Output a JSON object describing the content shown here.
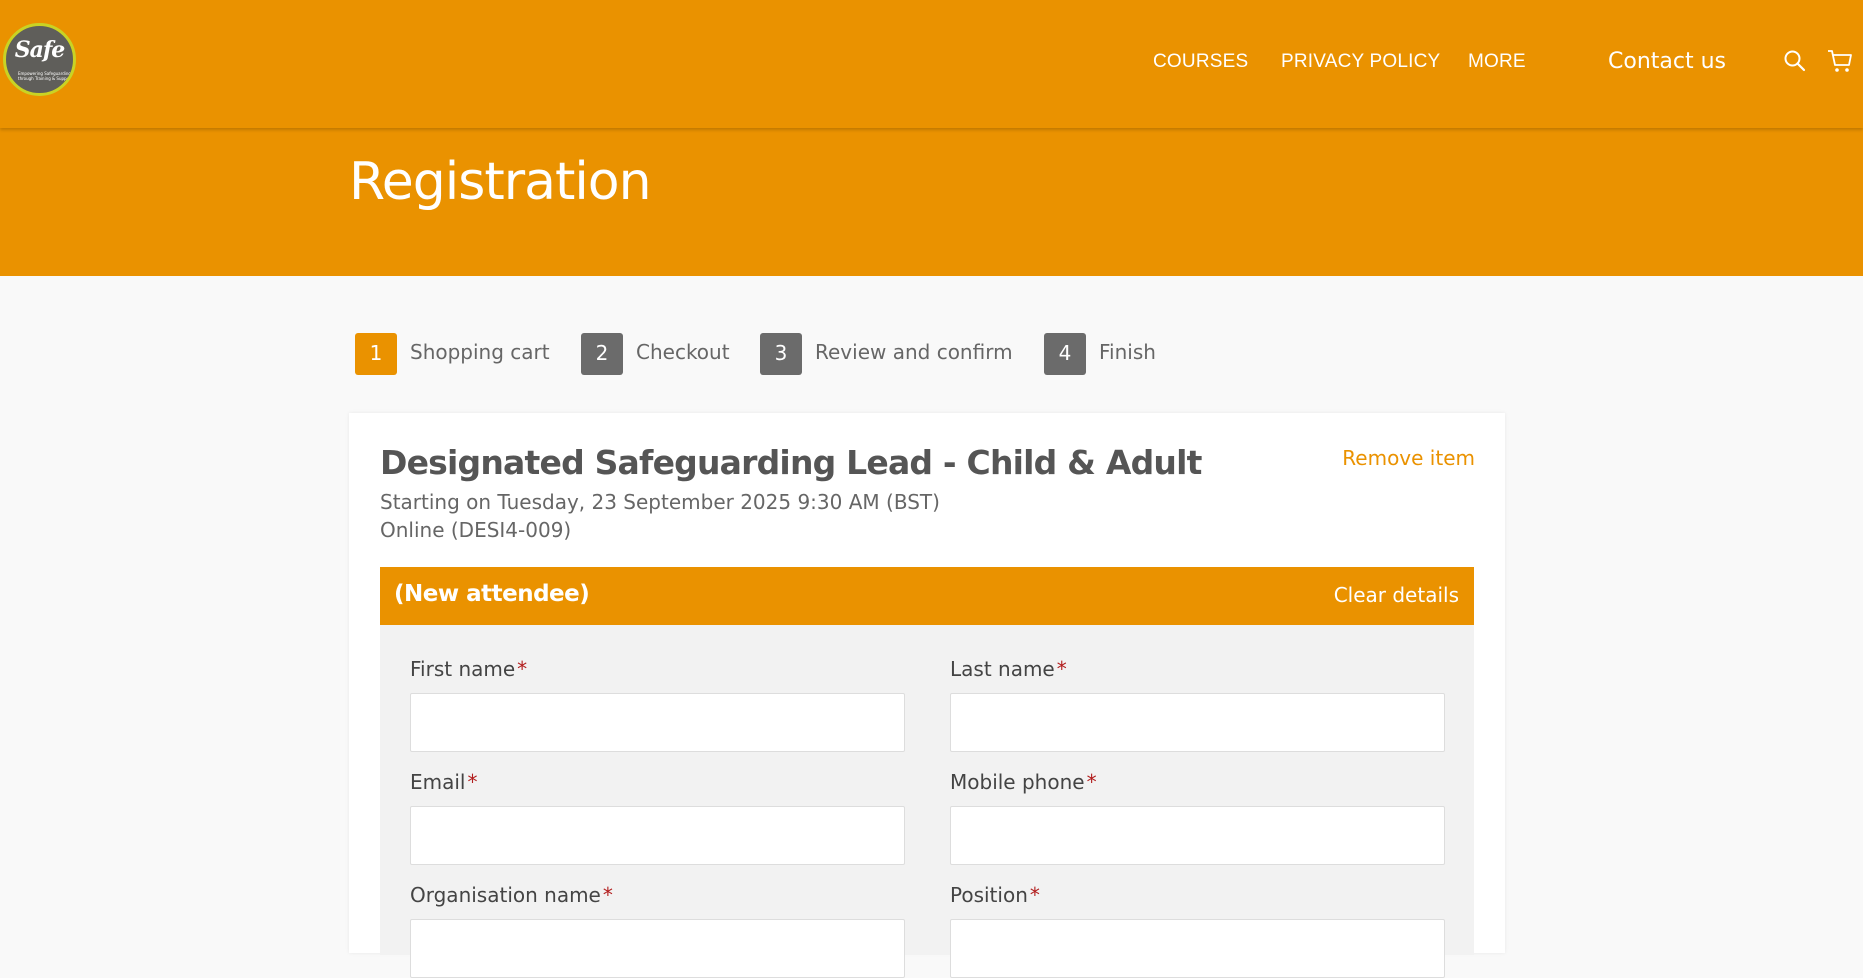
{
  "brand": {
    "logo_word": "Safe",
    "logo_tagline": "Empowering Safeguarding through Training & Support"
  },
  "nav": {
    "items": [
      {
        "label": "COURSES"
      },
      {
        "label": "PRIVACY POLICY"
      },
      {
        "label": "MORE"
      }
    ],
    "contact_label": "Contact us"
  },
  "icons": {
    "search": "search-icon",
    "cart": "cart-icon"
  },
  "page": {
    "title": "Registration"
  },
  "steps": [
    {
      "number": "1",
      "label": "Shopping cart",
      "active": true
    },
    {
      "number": "2",
      "label": "Checkout",
      "active": false
    },
    {
      "number": "3",
      "label": "Review and confirm",
      "active": false
    },
    {
      "number": "4",
      "label": "Finish",
      "active": false
    }
  ],
  "course": {
    "title": "Designated Safeguarding Lead - Child & Adult",
    "start": "Starting on Tuesday, 23 September 2025 9:30 AM (BST)",
    "location": "Online (DESI4-009)",
    "remove_label": "Remove item"
  },
  "attendee": {
    "name": "(New attendee)",
    "clear_label": "Clear details",
    "fields": [
      {
        "label": "First name",
        "required_mark": "*",
        "value": ""
      },
      {
        "label": "Last name",
        "required_mark": "*",
        "value": ""
      },
      {
        "label": "Email",
        "required_mark": "*",
        "value": ""
      },
      {
        "label": "Mobile phone",
        "required_mark": "*",
        "value": ""
      },
      {
        "label": "Organisation name",
        "required_mark": "*",
        "value": ""
      },
      {
        "label": "Position",
        "required_mark": "*",
        "value": ""
      }
    ]
  },
  "colors": {
    "brand_orange": "#ea9200",
    "step_active": "#ea9200",
    "step_inactive": "#6b6b6b",
    "required": "#b21d1d"
  }
}
